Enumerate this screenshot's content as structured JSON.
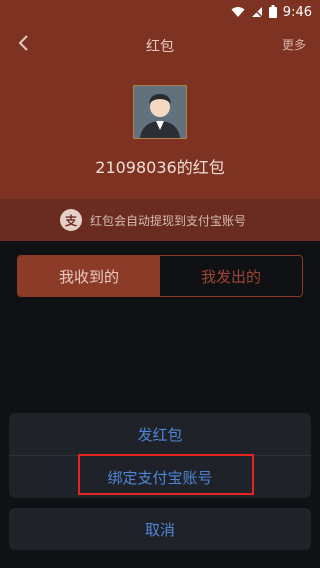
{
  "status_bar": {
    "time": "9:46",
    "icons": [
      "wifi-icon",
      "signal-icon",
      "battery-icon"
    ]
  },
  "nav": {
    "back_icon": "chevron-left-icon",
    "title": "红包",
    "more": "更多"
  },
  "profile": {
    "avatar_icon": "user-avatar-icon",
    "title": "21098036的红包"
  },
  "notice": {
    "icon": "alipay-icon",
    "icon_text": "支",
    "text": "红包会自动提现到支付宝账号"
  },
  "tabs": [
    {
      "label": "我收到的",
      "active": true
    },
    {
      "label": "我发出的",
      "active": false
    }
  ],
  "sheet": {
    "items": [
      {
        "label": "发红包"
      },
      {
        "label": "绑定支付宝账号"
      }
    ],
    "cancel": "取消"
  },
  "colors": {
    "header_bg": "#7e3322",
    "accent": "#8c3b28",
    "action_text": "#4f84d4",
    "highlight": "#e52421"
  }
}
